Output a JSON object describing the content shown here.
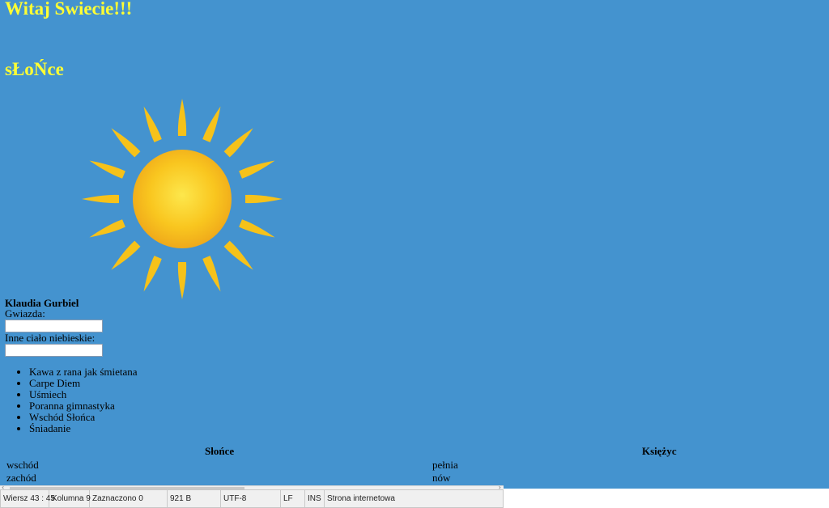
{
  "headings": {
    "title": "Witaj Swiecie!!!",
    "subtitle": "sŁoŃce"
  },
  "author": "Klaudia Gurbiel",
  "form": {
    "star_label": "Gwiazda:",
    "star_value": "",
    "other_label": "Inne ciało niebieskie:",
    "other_value": ""
  },
  "list": [
    "Kawa z rana jak śmietana",
    "Carpe Diem",
    "Uśmiech",
    "Poranna gimnastyka",
    "Wschód Słońca",
    "Śniadanie"
  ],
  "table": {
    "headers": [
      "Słońce",
      "Księżyc"
    ],
    "rows": [
      [
        "wschód",
        "pełnia"
      ],
      [
        "zachód",
        "nów"
      ]
    ]
  },
  "statusbar": {
    "position": "Wiersz 43 : 45",
    "column": "Kolumna 9",
    "selected": "Zaznaczono 0",
    "size": "921 B",
    "encoding": "UTF-8",
    "line_ending": "LF",
    "mode": "INS",
    "file_type": "Strona internetowa"
  },
  "colors": {
    "background": "#4493cf",
    "heading": "#ffff33",
    "sun": "#f6c21a"
  },
  "icons": {
    "sun_image": "sun-icon"
  }
}
